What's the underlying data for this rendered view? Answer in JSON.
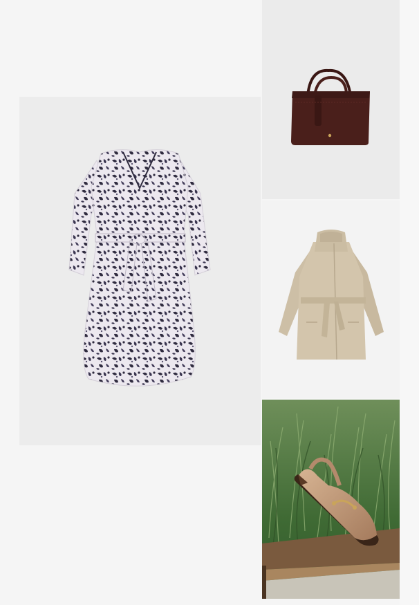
{
  "products": [
    {
      "name": "",
      "kind": "dress"
    },
    {
      "name": "",
      "kind": "handbag"
    },
    {
      "name": "",
      "kind": "coat"
    },
    {
      "name": "",
      "kind": "loafer"
    }
  ],
  "colors": {
    "page_background": "#f5f5f5",
    "dress_print_dark": "#2f2b3f",
    "dress_print_light": "#ece8ef",
    "bag_suede": "#4a1f1b",
    "coat_beige": "#cdbfa6",
    "shoe_tan": "#b48a6c",
    "grass_green": "#4f7a3e",
    "bench_wood": "#7a5a3e"
  }
}
